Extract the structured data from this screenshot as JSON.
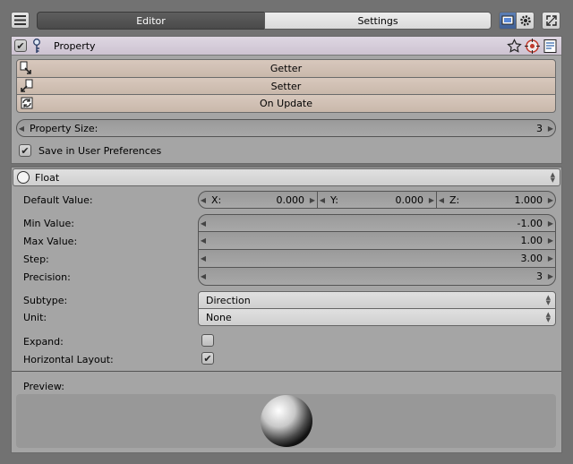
{
  "header": {
    "tabs": [
      {
        "label": "Editor",
        "active": true
      },
      {
        "label": "Settings",
        "active": false
      }
    ]
  },
  "property": {
    "title": "Property",
    "enabled": true,
    "functions": {
      "getter": "Getter",
      "setter": "Setter",
      "on_update": "On Update"
    },
    "size": {
      "label": "Property Size:",
      "value": "3"
    },
    "save_prefs": {
      "label": "Save in User Preferences",
      "checked": true
    }
  },
  "type_panel": {
    "title": "Float",
    "default_value": {
      "label": "Default Value:",
      "x": {
        "label": "X:",
        "value": "0.000"
      },
      "y": {
        "label": "Y:",
        "value": "0.000"
      },
      "z": {
        "label": "Z:",
        "value": "1.000"
      }
    },
    "min": {
      "label": "Min Value:",
      "value": "-1.00"
    },
    "max": {
      "label": "Max Value:",
      "value": "1.00"
    },
    "step": {
      "label": "Step:",
      "value": "3.00"
    },
    "precision": {
      "label": "Precision:",
      "value": "3"
    },
    "subtype": {
      "label": "Subtype:",
      "value": "Direction"
    },
    "unit": {
      "label": "Unit:",
      "value": "None"
    },
    "expand": {
      "label": "Expand:",
      "checked": false
    },
    "horizontal_layout": {
      "label": "Horizontal Layout:",
      "checked": true
    },
    "preview_label": "Preview:"
  },
  "colors": {
    "accent_header": "#d8d0dc",
    "operator_row": "#d3c3b7",
    "panel": "#a5a5a5"
  }
}
